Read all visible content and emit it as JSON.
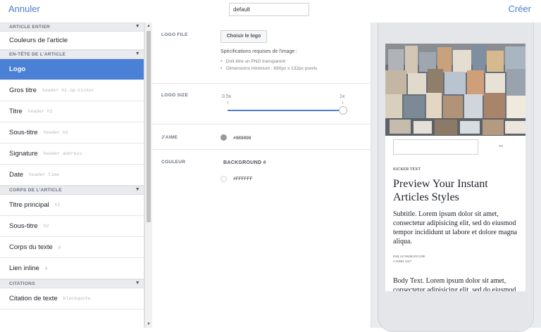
{
  "topbar": {
    "cancel_label": "Annuler",
    "create_label": "Créer",
    "style_name_value": "default"
  },
  "sidebar": {
    "sections": [
      {
        "title": "ARTICLE ENTIER",
        "items": [
          {
            "label": "Couleurs de l'article",
            "tag": ""
          }
        ]
      },
      {
        "title": "EN-TÊTE DE L'ARTICLE",
        "items": [
          {
            "label": "Logo",
            "tag": ""
          },
          {
            "label": "Gros titre",
            "tag": "header h1.op-kicker"
          },
          {
            "label": "Titre",
            "tag": "header h1"
          },
          {
            "label": "Sous-titre",
            "tag": "header h2"
          },
          {
            "label": "Signature",
            "tag": "header address"
          },
          {
            "label": "Date",
            "tag": "header time"
          }
        ]
      },
      {
        "title": "CORPS DE L'ARTICLE",
        "items": [
          {
            "label": "Titre principal",
            "tag": "h1"
          },
          {
            "label": "Sous-titre",
            "tag": "h2"
          },
          {
            "label": "Corps du texte",
            "tag": "p"
          },
          {
            "label": "Lien inline",
            "tag": "a"
          }
        ]
      },
      {
        "title": "CITATIONS",
        "items": [
          {
            "label": "Citation de texte",
            "tag": "blockquote"
          }
        ]
      }
    ]
  },
  "settings": {
    "logo_file": {
      "label": "LOGO FILE",
      "button": "Choisir le logo",
      "spec_title": "Spécifications requises de l'image :",
      "specs": [
        "Doit être un PNG transparent",
        "Dimensions minimum : 690px x 132px porels"
      ]
    },
    "logo_size": {
      "label": "LOGO SIZE",
      "min_label": "0.5x",
      "max_label": "1x",
      "value_fraction": 1.0
    },
    "jaime": {
      "label": "J'AIME",
      "color": "#989898",
      "hex": "#989898"
    },
    "couleur": {
      "label": "COULEUR",
      "sub_label": "BACKGROUND #",
      "color": "#FFFFFF",
      "hex": "#FFFFFF"
    }
  },
  "preview": {
    "kicker": "KICKER TEXT",
    "title": "Preview Your Instant Articles Styles",
    "subtitle": "Subtitle. Lorem ipsum dolor sit amet, consectetur adipisicing elit, sed do eiusmod tempor incididunt ut labore et dolore magna aliqua.",
    "byline": "PAR AUTHOR BYLINE",
    "date": "2 AVRIL 2017",
    "body": "Body Text. Lorem ipsum dolor sit amet, consectetur adipisicing elit, sed do eiusmod"
  },
  "colors": {
    "accent": "#4a80d6",
    "link": "#4a7bd0"
  }
}
